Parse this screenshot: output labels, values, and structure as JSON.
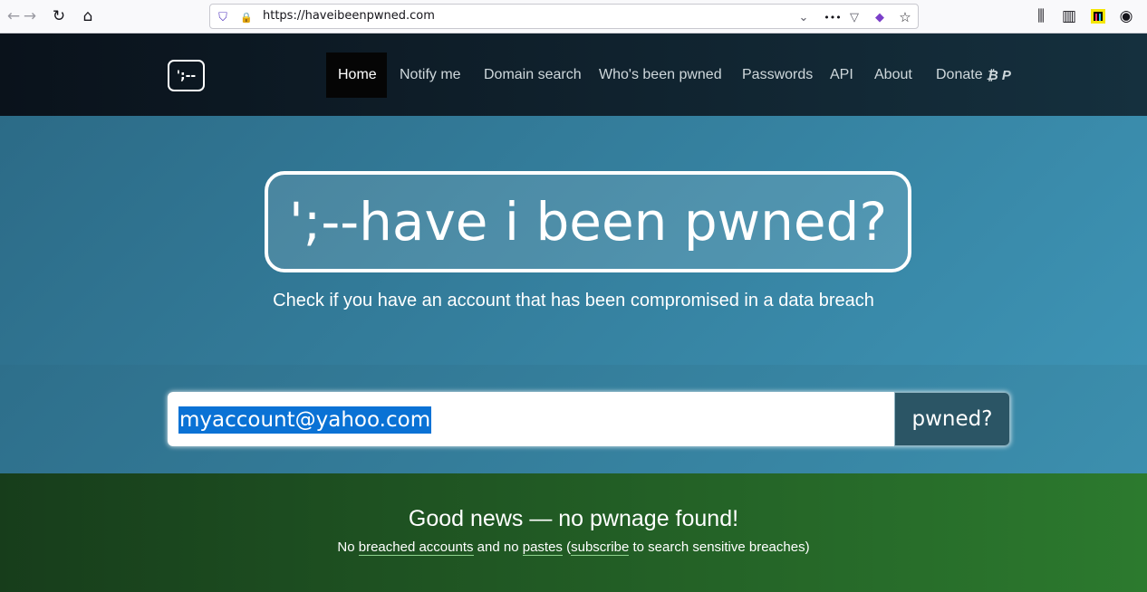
{
  "browser": {
    "url": "https://haveibeenpwned.com",
    "icons": {
      "back": "←",
      "forward": "→",
      "reload": "↻",
      "home": "⌂",
      "tracking": "⛉",
      "lock": "🔒",
      "chevron": "⌄",
      "more": "•••",
      "pocket": "▽",
      "extension": "◆",
      "bookmark": "☆",
      "library": "⫼",
      "sidebar": "▥",
      "account": "◉"
    }
  },
  "nav": {
    "logo": "';--",
    "items": [
      {
        "label": "Home"
      },
      {
        "label": "Notify me"
      },
      {
        "label": "Domain search"
      },
      {
        "label": "Who's been pwned"
      },
      {
        "label": "Passwords"
      },
      {
        "label": "API"
      },
      {
        "label": "About"
      },
      {
        "label": "Donate"
      }
    ],
    "donate_icons": "₿ P"
  },
  "hero": {
    "title": "';--have i been pwned?",
    "subtitle": "Check if you have an account that has been compromised in a data breach"
  },
  "search": {
    "value": "myaccount@yahoo.com",
    "button_label": "pwned?"
  },
  "result": {
    "title": "Good news — no pwnage found!",
    "text_1": "No ",
    "link_1": "breached accounts",
    "text_2": " and no ",
    "link_2": "pastes",
    "text_3": " (",
    "link_3": "subscribe",
    "text_4": " to search sensitive breaches)"
  },
  "colors": {
    "nav_bg": "#0a121b",
    "hero_bg": "#3d93b4",
    "result_bg": "#2c7a2e",
    "selection": "#0a72d5"
  }
}
